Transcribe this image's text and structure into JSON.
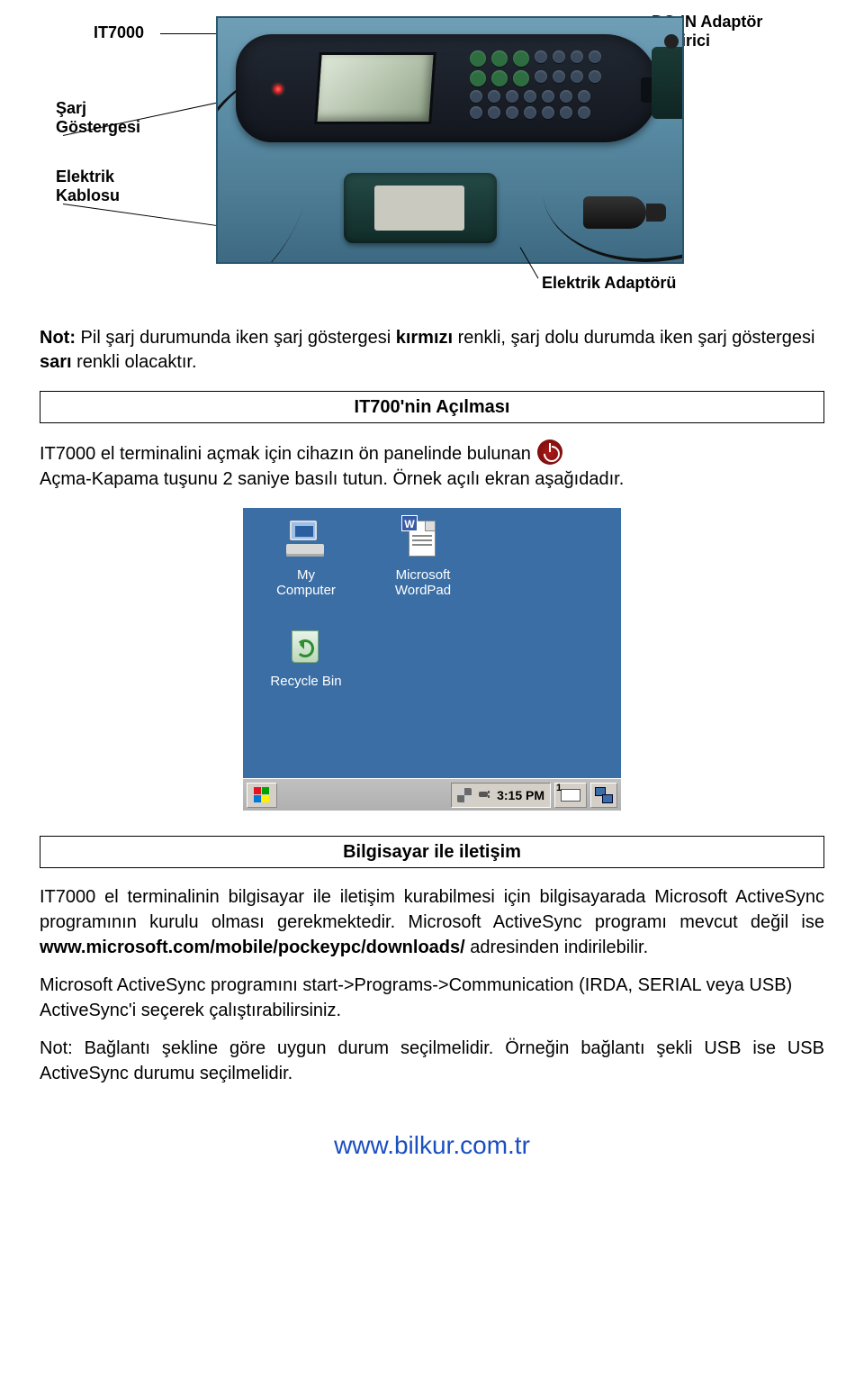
{
  "diagram": {
    "lbl_it7000": "IT7000",
    "lbl_dcin": "DC-IN Adaptör\nÇevirici",
    "lbl_sarj": "Şarj\nGöstergesi",
    "lbl_elektrik_kablosu": "Elektrik\nKablosu",
    "lbl_elektrik_adaptoru": "Elektrik Adaptörü"
  },
  "note": {
    "prefix": "Not:",
    "text_before_k": " Pil şarj durumunda iken şarj göstergesi ",
    "kirmizi": "kırmızı",
    "text_mid": " renkli, şarj dolu durumda iken şarj göstergesi ",
    "sari": "sarı",
    "text_after": " renkli olacaktır."
  },
  "section1": "IT700'nin Açılması",
  "para1a": "IT7000 el terminalini açmak için cihazın ön panelinde bulunan",
  "para1b": "Açma-Kapama tuşunu 2 saniye basılı tutun. Örnek açılı ekran aşağıdadır.",
  "wince": {
    "my_computer": "My\nComputer",
    "wordpad": "Microsoft\nWordPad",
    "recycle_bin": "Recycle Bin",
    "time": "3:15 PM"
  },
  "section2": "Bilgisayar ile iletişim",
  "para2": "IT7000 el terminalinin bilgisayar ile iletişim kurabilmesi için bilgisayarada Microsoft ActiveSync programının kurulu olması gerekmektedir. Microsoft ActiveSync programı mevcut değil ise ",
  "para2_link": "www.microsoft.com/mobile/pockeypc/downloads/",
  "para2_after": " adresinden indirilebilir.",
  "para3": "Microsoft ActiveSync programını start->Programs->Communication (IRDA, SERIAL veya USB) ActiveSync'i seçerek çalıştırabilirsiniz.",
  "para4": "Not: Bağlantı şekline göre uygun durum seçilmelidir. Örneğin bağlantı şekli USB ise USB ActiveSync durumu seçilmelidir.",
  "footer": "www.bilkur.com.tr"
}
